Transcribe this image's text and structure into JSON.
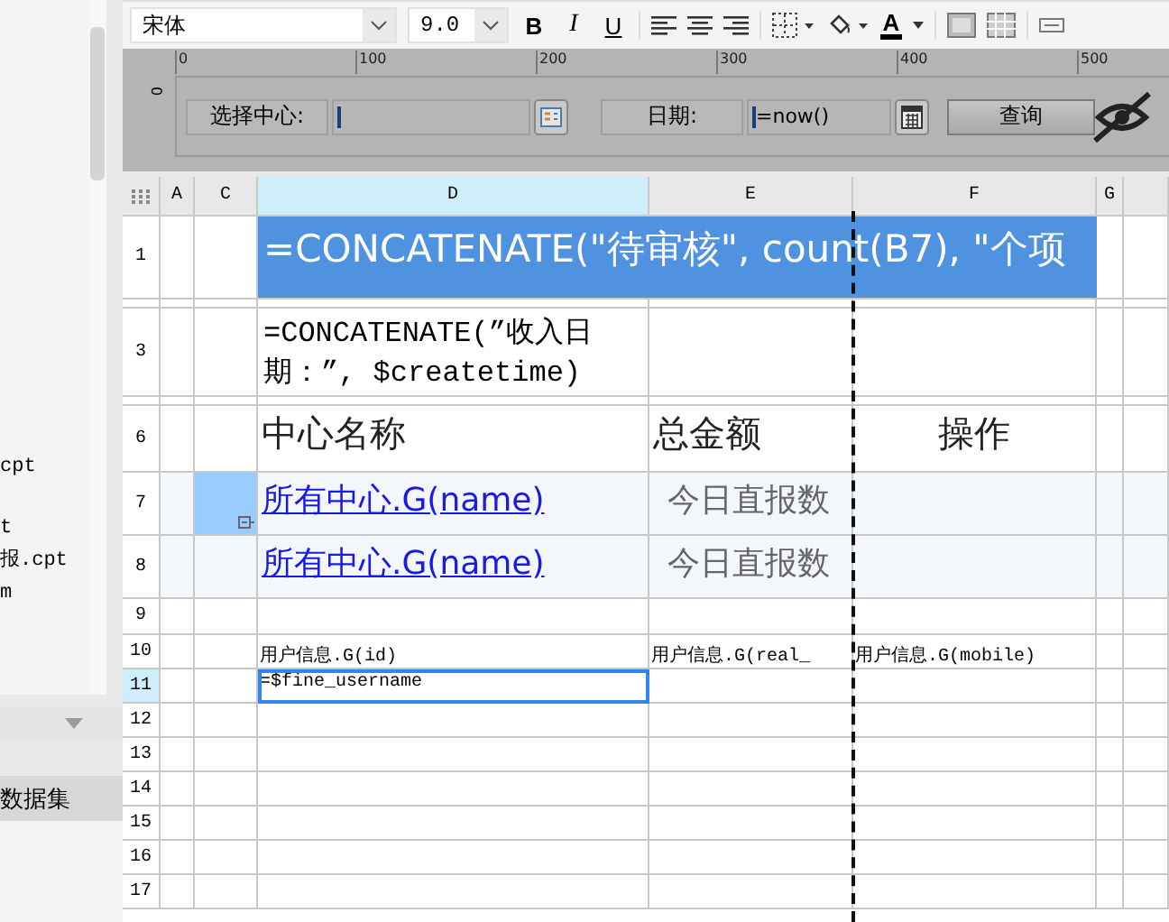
{
  "sidebar": {
    "files": [
      "cpt",
      "t",
      "报.cpt",
      "m"
    ],
    "tab": "数据集"
  },
  "toolbar": {
    "font": "宋体",
    "size": "9.0",
    "bold": "B",
    "italic": "I",
    "underline": "U",
    "font_color": "A"
  },
  "ruler": {
    "ticks": [
      "0",
      "100",
      "200",
      "300",
      "400",
      "500"
    ],
    "vertical_tick": "0"
  },
  "parameters": {
    "center_label": "选择中心:",
    "date_label": "日期:",
    "date_value": "=now()",
    "query_button": "查询"
  },
  "sheet": {
    "columns": [
      {
        "label": "A",
        "selected": false
      },
      {
        "label": "C",
        "selected": false
      },
      {
        "label": "D",
        "selected": true
      },
      {
        "label": "E",
        "selected": false
      },
      {
        "label": "F",
        "selected": false
      },
      {
        "label": "G",
        "selected": false
      }
    ],
    "rows": [
      {
        "label": "1",
        "kind": "title",
        "selected": false,
        "cells": [
          {
            "kind": "empty"
          },
          {
            "kind": "empty"
          },
          {
            "kind": "title",
            "text": "=CONCATENATE(\"待审核\", count(B7), \"个项"
          },
          {
            "kind": "empty"
          }
        ]
      },
      {
        "kind": "hidden",
        "selected": false,
        "cells": [
          {
            "kind": "empty"
          },
          {
            "kind": "empty"
          },
          {
            "kind": "empty"
          },
          {
            "kind": "empty"
          },
          {
            "kind": "empty"
          },
          {
            "kind": "empty"
          }
        ]
      },
      {
        "label": "3",
        "kind": "formula",
        "selected": false,
        "cells": [
          {
            "kind": "empty"
          },
          {
            "kind": "empty"
          },
          {
            "kind": "formula",
            "text": "=CONCATENATE(”收入日期：”, $createtime)"
          },
          {
            "kind": "empty"
          },
          {
            "kind": "empty"
          },
          {
            "kind": "empty"
          }
        ]
      },
      {
        "kind": "hidden",
        "selected": false,
        "cells": [
          {
            "kind": "empty"
          },
          {
            "kind": "empty"
          },
          {
            "kind": "empty"
          },
          {
            "kind": "empty"
          },
          {
            "kind": "empty"
          },
          {
            "kind": "empty"
          }
        ]
      },
      {
        "label": "6",
        "kind": "heading",
        "selected": false,
        "cells": [
          {
            "kind": "empty"
          },
          {
            "kind": "empty"
          },
          {
            "kind": "heading",
            "text": "中心名称"
          },
          {
            "kind": "heading",
            "text": "总金额"
          },
          {
            "kind": "heading-center",
            "text": "操作"
          },
          {
            "kind": "empty"
          }
        ]
      },
      {
        "label": "7",
        "kind": "data",
        "selected": false,
        "cells": [
          {
            "kind": "empty"
          },
          {
            "kind": "marked"
          },
          {
            "kind": "link",
            "text": "所有中心.G(name)"
          },
          {
            "kind": "muted",
            "text": "今日直报数"
          },
          {
            "kind": "empty"
          },
          {
            "kind": "empty"
          }
        ]
      },
      {
        "label": "8",
        "kind": "data",
        "selected": false,
        "cells": [
          {
            "kind": "empty"
          },
          {
            "kind": "empty"
          },
          {
            "kind": "link",
            "text": "所有中心.G(name)"
          },
          {
            "kind": "muted",
            "text": "今日直报数"
          },
          {
            "kind": "empty"
          },
          {
            "kind": "empty"
          }
        ]
      },
      {
        "label": "9",
        "kind": "spacer",
        "selected": false,
        "cells": [
          {
            "kind": "empty"
          },
          {
            "kind": "empty"
          },
          {
            "kind": "empty"
          },
          {
            "kind": "empty"
          },
          {
            "kind": "empty"
          },
          {
            "kind": "empty"
          }
        ]
      },
      {
        "label": "10",
        "kind": "normal",
        "selected": false,
        "cells": [
          {
            "kind": "empty"
          },
          {
            "kind": "empty"
          },
          {
            "kind": "plain",
            "text": "用户信息.G(id)"
          },
          {
            "kind": "plain",
            "text": "用户信息.G(real_"
          },
          {
            "kind": "plain",
            "text": "用户信息.G(mobile)"
          },
          {
            "kind": "empty"
          }
        ]
      },
      {
        "label": "11",
        "kind": "normal",
        "selected": true,
        "cells": [
          {
            "kind": "empty"
          },
          {
            "kind": "empty"
          },
          {
            "kind": "editing",
            "text": "=$fine_username"
          },
          {
            "kind": "empty"
          },
          {
            "kind": "empty"
          },
          {
            "kind": "empty"
          }
        ]
      },
      {
        "label": "12",
        "kind": "normal",
        "selected": false,
        "cells": [
          {
            "kind": "empty"
          },
          {
            "kind": "empty"
          },
          {
            "kind": "empty"
          },
          {
            "kind": "empty"
          },
          {
            "kind": "empty"
          },
          {
            "kind": "empty"
          }
        ]
      },
      {
        "label": "13",
        "kind": "normal",
        "selected": false,
        "cells": [
          {
            "kind": "empty"
          },
          {
            "kind": "empty"
          },
          {
            "kind": "empty"
          },
          {
            "kind": "empty"
          },
          {
            "kind": "empty"
          },
          {
            "kind": "empty"
          }
        ]
      },
      {
        "label": "14",
        "kind": "normal",
        "selected": false,
        "cells": [
          {
            "kind": "empty"
          },
          {
            "kind": "empty"
          },
          {
            "kind": "empty"
          },
          {
            "kind": "empty"
          },
          {
            "kind": "empty"
          },
          {
            "kind": "empty"
          }
        ]
      },
      {
        "label": "15",
        "kind": "normal",
        "selected": false,
        "cells": [
          {
            "kind": "empty"
          },
          {
            "kind": "empty"
          },
          {
            "kind": "empty"
          },
          {
            "kind": "empty"
          },
          {
            "kind": "empty"
          },
          {
            "kind": "empty"
          }
        ]
      },
      {
        "label": "16",
        "kind": "normal",
        "selected": false,
        "cells": [
          {
            "kind": "empty"
          },
          {
            "kind": "empty"
          },
          {
            "kind": "empty"
          },
          {
            "kind": "empty"
          },
          {
            "kind": "empty"
          },
          {
            "kind": "empty"
          }
        ]
      },
      {
        "label": "17",
        "kind": "normal",
        "selected": false,
        "cells": [
          {
            "kind": "empty"
          },
          {
            "kind": "empty"
          },
          {
            "kind": "empty"
          },
          {
            "kind": "empty"
          },
          {
            "kind": "empty"
          },
          {
            "kind": "empty"
          }
        ]
      }
    ]
  }
}
